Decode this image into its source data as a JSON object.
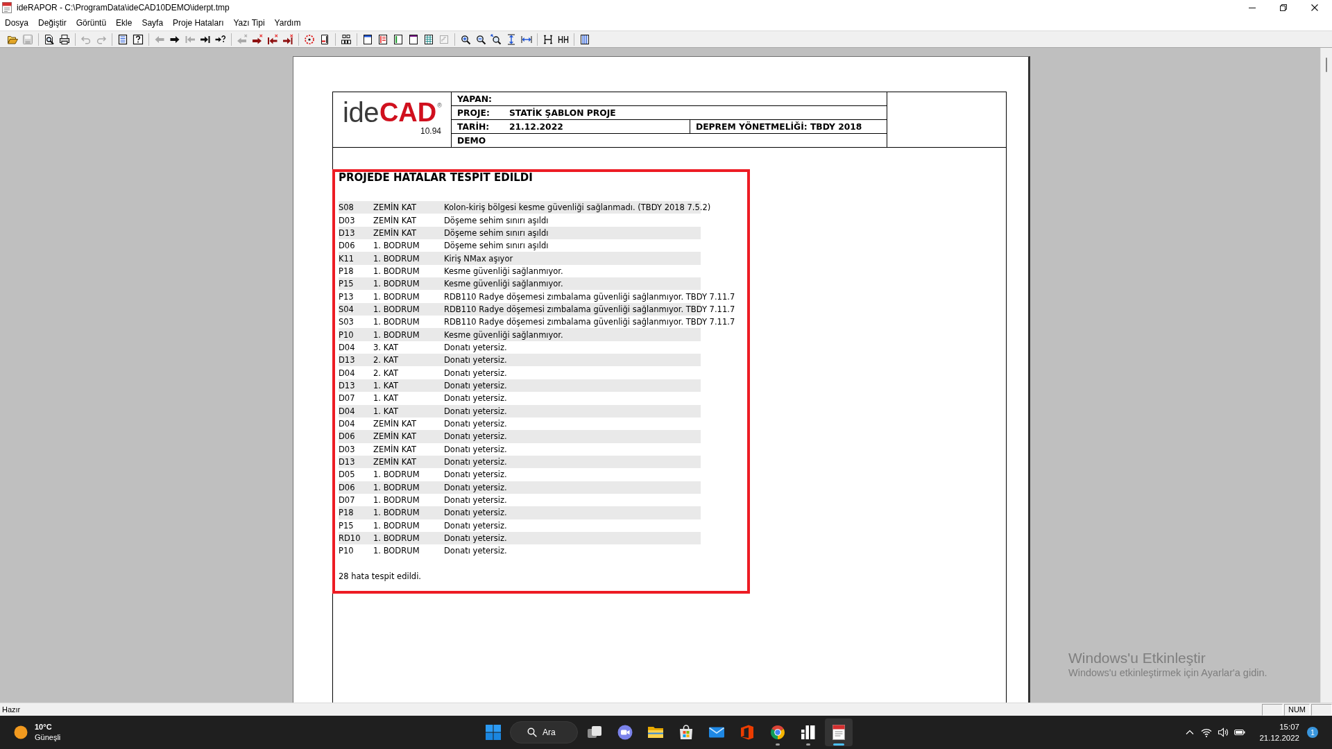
{
  "window": {
    "title": "ideRAPOR - C:\\ProgramData\\ideCAD10DEMO\\iderpt.tmp"
  },
  "menu": [
    "Dosya",
    "Değiştir",
    "Görüntü",
    "Ekle",
    "Sayfa",
    "Proje Hataları",
    "Yazı Tipi",
    "Yardım"
  ],
  "toolbar": [
    {
      "kind": "open",
      "disabled": false
    },
    {
      "kind": "save",
      "disabled": true
    },
    {
      "kind": "separator"
    },
    {
      "kind": "preview",
      "disabled": false
    },
    {
      "kind": "print",
      "disabled": false
    },
    {
      "kind": "separator"
    },
    {
      "kind": "undo",
      "disabled": true
    },
    {
      "kind": "redo",
      "disabled": true
    },
    {
      "kind": "separator"
    },
    {
      "kind": "report",
      "disabled": false
    },
    {
      "kind": "help",
      "disabled": false
    },
    {
      "kind": "separator"
    },
    {
      "kind": "prev",
      "disabled": true
    },
    {
      "kind": "next",
      "disabled": false
    },
    {
      "kind": "first",
      "disabled": true
    },
    {
      "kind": "last",
      "disabled": false
    },
    {
      "kind": "goto",
      "disabled": false
    },
    {
      "kind": "separator"
    },
    {
      "kind": "error_prev",
      "disabled": true
    },
    {
      "kind": "error_next",
      "disabled": false
    },
    {
      "kind": "error_first",
      "disabled": false
    },
    {
      "kind": "error_last",
      "disabled": false
    },
    {
      "kind": "separator"
    },
    {
      "kind": "error_circle",
      "disabled": false
    },
    {
      "kind": "error_page",
      "disabled": false
    },
    {
      "kind": "separator"
    },
    {
      "kind": "blocks",
      "disabled": false
    },
    {
      "kind": "separator"
    },
    {
      "kind": "layout_header",
      "disabled": false
    },
    {
      "kind": "layout_left",
      "disabled": false
    },
    {
      "kind": "layout_bar",
      "disabled": false
    },
    {
      "kind": "layout_top",
      "disabled": false
    },
    {
      "kind": "layout_grid",
      "disabled": false
    },
    {
      "kind": "layout_corner",
      "disabled": true
    },
    {
      "kind": "separator"
    },
    {
      "kind": "zoom_in",
      "disabled": false
    },
    {
      "kind": "zoom",
      "disabled": false
    },
    {
      "kind": "zoom_fit",
      "disabled": false
    },
    {
      "kind": "fit_height",
      "disabled": false
    },
    {
      "kind": "fit_width",
      "disabled": false
    },
    {
      "kind": "separator"
    },
    {
      "kind": "one_page",
      "disabled": false
    },
    {
      "kind": "two_pages",
      "disabled": false
    },
    {
      "kind": "separator"
    },
    {
      "kind": "columns",
      "disabled": false
    }
  ],
  "report": {
    "logo": {
      "light": "ide",
      "bold": "CAD",
      "mark": "®",
      "version": "10.94"
    },
    "header": [
      {
        "label": "YAPAN:"
      },
      {
        "label": "PROJE:",
        "value": "STATİK ŞABLON PROJE"
      },
      {
        "label": "TARİH:",
        "value": "21.12.2022",
        "note": "DEPREM YÖNETMELİĞİ: TBDY 2018"
      },
      {
        "label": "DEMO"
      }
    ],
    "errors": {
      "title": "PROJEDE HATALAR TESPIT EDILDI",
      "rows": [
        {
          "element": "S08",
          "floor": "ZEMİN KAT",
          "message": "Kolon-kiriş bölgesi kesme güvenliği sağlanmadı. (TBDY 2018 7.5.2)"
        },
        {
          "element": "D03",
          "floor": "ZEMİN KAT",
          "message": "Döşeme sehim sınırı aşıldı"
        },
        {
          "element": "D13",
          "floor": "ZEMİN KAT",
          "message": "Döşeme sehim sınırı aşıldı"
        },
        {
          "element": "D06",
          "floor": "1. BODRUM",
          "message": "Döşeme sehim sınırı aşıldı"
        },
        {
          "element": "K11",
          "floor": "1. BODRUM",
          "message": "Kiriş NMax aşıyor"
        },
        {
          "element": "P18",
          "floor": "1. BODRUM",
          "message": "Kesme güvenliği sağlanmıyor."
        },
        {
          "element": "P15",
          "floor": "1. BODRUM",
          "message": "Kesme güvenliği sağlanmıyor."
        },
        {
          "element": "P13",
          "floor": "1. BODRUM",
          "message": "RDB110 Radye döşemesi zımbalama güvenliği sağlanmıyor. TBDY 7.11.7"
        },
        {
          "element": "S04",
          "floor": "1. BODRUM",
          "message": "RDB110 Radye döşemesi zımbalama güvenliği sağlanmıyor. TBDY 7.11.7"
        },
        {
          "element": "S03",
          "floor": "1. BODRUM",
          "message": "RDB110 Radye döşemesi zımbalama güvenliği sağlanmıyor. TBDY 7.11.7"
        },
        {
          "element": "P10",
          "floor": "1. BODRUM",
          "message": "Kesme güvenliği sağlanmıyor."
        },
        {
          "element": "D04",
          "floor": "3. KAT",
          "message": "Donatı yetersiz."
        },
        {
          "element": "D13",
          "floor": "2. KAT",
          "message": "Donatı yetersiz."
        },
        {
          "element": "D04",
          "floor": "2. KAT",
          "message": "Donatı yetersiz."
        },
        {
          "element": "D13",
          "floor": "1. KAT",
          "message": "Donatı yetersiz."
        },
        {
          "element": "D07",
          "floor": "1. KAT",
          "message": "Donatı yetersiz."
        },
        {
          "element": "D04",
          "floor": "1. KAT",
          "message": "Donatı yetersiz."
        },
        {
          "element": "D04",
          "floor": "ZEMİN KAT",
          "message": "Donatı yetersiz."
        },
        {
          "element": "D06",
          "floor": "ZEMİN KAT",
          "message": "Donatı yetersiz."
        },
        {
          "element": "D03",
          "floor": "ZEMİN KAT",
          "message": "Donatı yetersiz."
        },
        {
          "element": "D13",
          "floor": "ZEMİN KAT",
          "message": "Donatı yetersiz."
        },
        {
          "element": "D05",
          "floor": "1. BODRUM",
          "message": "Donatı yetersiz."
        },
        {
          "element": "D06",
          "floor": "1. BODRUM",
          "message": "Donatı yetersiz."
        },
        {
          "element": "D07",
          "floor": "1. BODRUM",
          "message": "Donatı yetersiz."
        },
        {
          "element": "P18",
          "floor": "1. BODRUM",
          "message": "Donatı yetersiz."
        },
        {
          "element": "P15",
          "floor": "1. BODRUM",
          "message": "Donatı yetersiz."
        },
        {
          "element": "RD10",
          "floor": "1. BODRUM",
          "message": "Donatı yetersiz."
        },
        {
          "element": "P10",
          "floor": "1. BODRUM",
          "message": "Donatı yetersiz."
        }
      ],
      "summary": "28 hata tespit edildi."
    }
  },
  "activation_notice": {
    "title": "Windows'u Etkinleştir",
    "text": "Windows'u etkinleştirmek için Ayarlar'a gidin."
  },
  "status_bar": {
    "text": "Hazır",
    "panels": [
      {
        "kind": "empty"
      },
      {
        "kind": "text",
        "label": "NUM"
      },
      {
        "kind": "empty"
      }
    ]
  },
  "taskbar": {
    "weather": {
      "temperature": "10°C",
      "condition": "Güneşli"
    },
    "search": {
      "label": "Ara"
    },
    "apps": [
      {
        "kind": "task_view",
        "running": false,
        "selected": false
      },
      {
        "kind": "chat",
        "running": false,
        "selected": false
      },
      {
        "kind": "explorer",
        "running": false,
        "selected": false
      },
      {
        "kind": "store",
        "running": false,
        "selected": false
      },
      {
        "kind": "mail",
        "running": false,
        "selected": false
      },
      {
        "kind": "office",
        "running": false,
        "selected": false
      },
      {
        "kind": "chrome",
        "running": true,
        "selected": false
      },
      {
        "kind": "bars_app",
        "running": true,
        "selected": false
      },
      {
        "kind": "report_app",
        "running": true,
        "selected": true
      }
    ],
    "clock": {
      "time": "15:07",
      "date": "21.12.2022"
    },
    "notification_count": "1"
  }
}
